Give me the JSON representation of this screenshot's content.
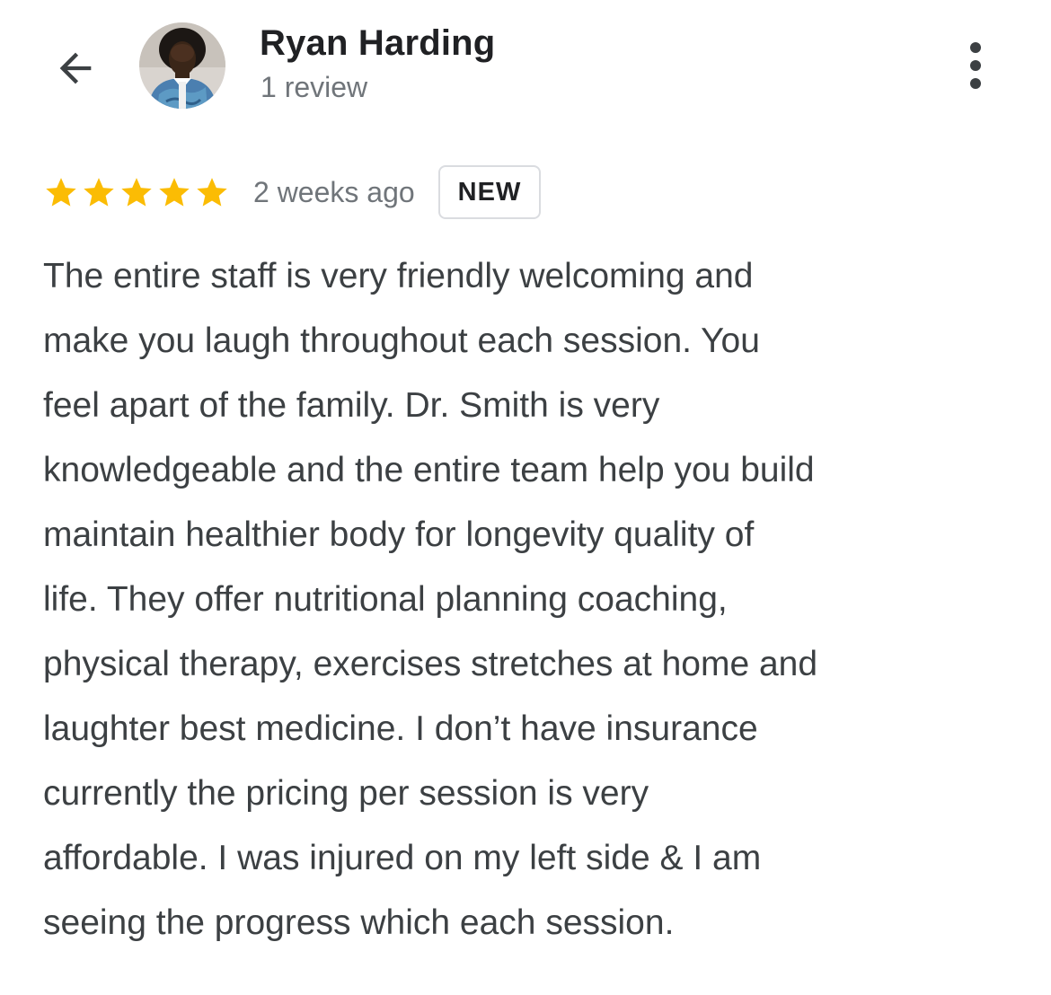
{
  "header": {
    "back_icon": "arrow-left-icon",
    "reviewer_name": "Ryan Harding",
    "review_count": "1 review",
    "more_icon": "more-vert-icon"
  },
  "review": {
    "rating": 5,
    "max_rating": 5,
    "star_color": "#fbbc04",
    "time": "2 weeks ago",
    "badge": "NEW",
    "text": "The entire staff is very friendly welcoming and\nmake you laugh throughout each session. You\nfeel apart of the family. Dr. Smith is very\nknowledgeable and the entire team help you build\nmaintain healthier body for longevity quality of\nlife. They offer nutritional planning coaching,\nphysical therapy, exercises stretches at home and\nlaughter best medicine. I don’t have insurance\ncurrently the pricing per session is very\naffordable. I was injured on my left side & I am\nseeing the progress which each session."
  }
}
